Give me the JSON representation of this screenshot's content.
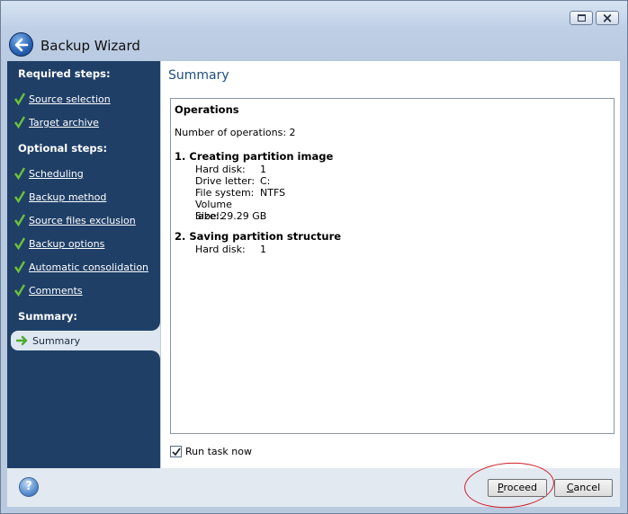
{
  "window": {
    "title": "Backup Wizard"
  },
  "sidebar": {
    "required_label": "Required steps:",
    "required": [
      "Source selection",
      "Target archive"
    ],
    "optional_label": "Optional steps:",
    "optional": [
      "Scheduling",
      "Backup method",
      "Source files exclusion",
      "Backup options",
      "Automatic consolidation",
      "Comments"
    ],
    "summary_label": "Summary:",
    "current": "Summary"
  },
  "main": {
    "title": "Summary",
    "operations_heading": "Operations",
    "num_operations": "Number of operations: 2",
    "op1": {
      "title": "1. Creating partition image",
      "hard_disk_k": "Hard disk:",
      "hard_disk_v": "1",
      "drive_letter_k": "Drive letter:",
      "drive_letter_v": "C:",
      "file_system_k": "File system:",
      "file_system_v": "NTFS",
      "volume_label_k": "Volume label:",
      "volume_label_v": "",
      "size_k": "Size:",
      "size_v": "29.29 GB"
    },
    "op2": {
      "title": "2. Saving partition structure",
      "hard_disk_k": "Hard disk:",
      "hard_disk_v": "1"
    },
    "run_now_label": "Run task now",
    "run_now_checked": true
  },
  "buttons": {
    "help": "?",
    "proceed_u": "P",
    "proceed_rest": "roceed",
    "cancel_u": "C",
    "cancel_rest": "ancel"
  },
  "colors": {
    "sidebar": "#1f3f67",
    "check": "#6cc23a",
    "accent_title": "#1f4f80",
    "annotation": "#d0202a"
  }
}
